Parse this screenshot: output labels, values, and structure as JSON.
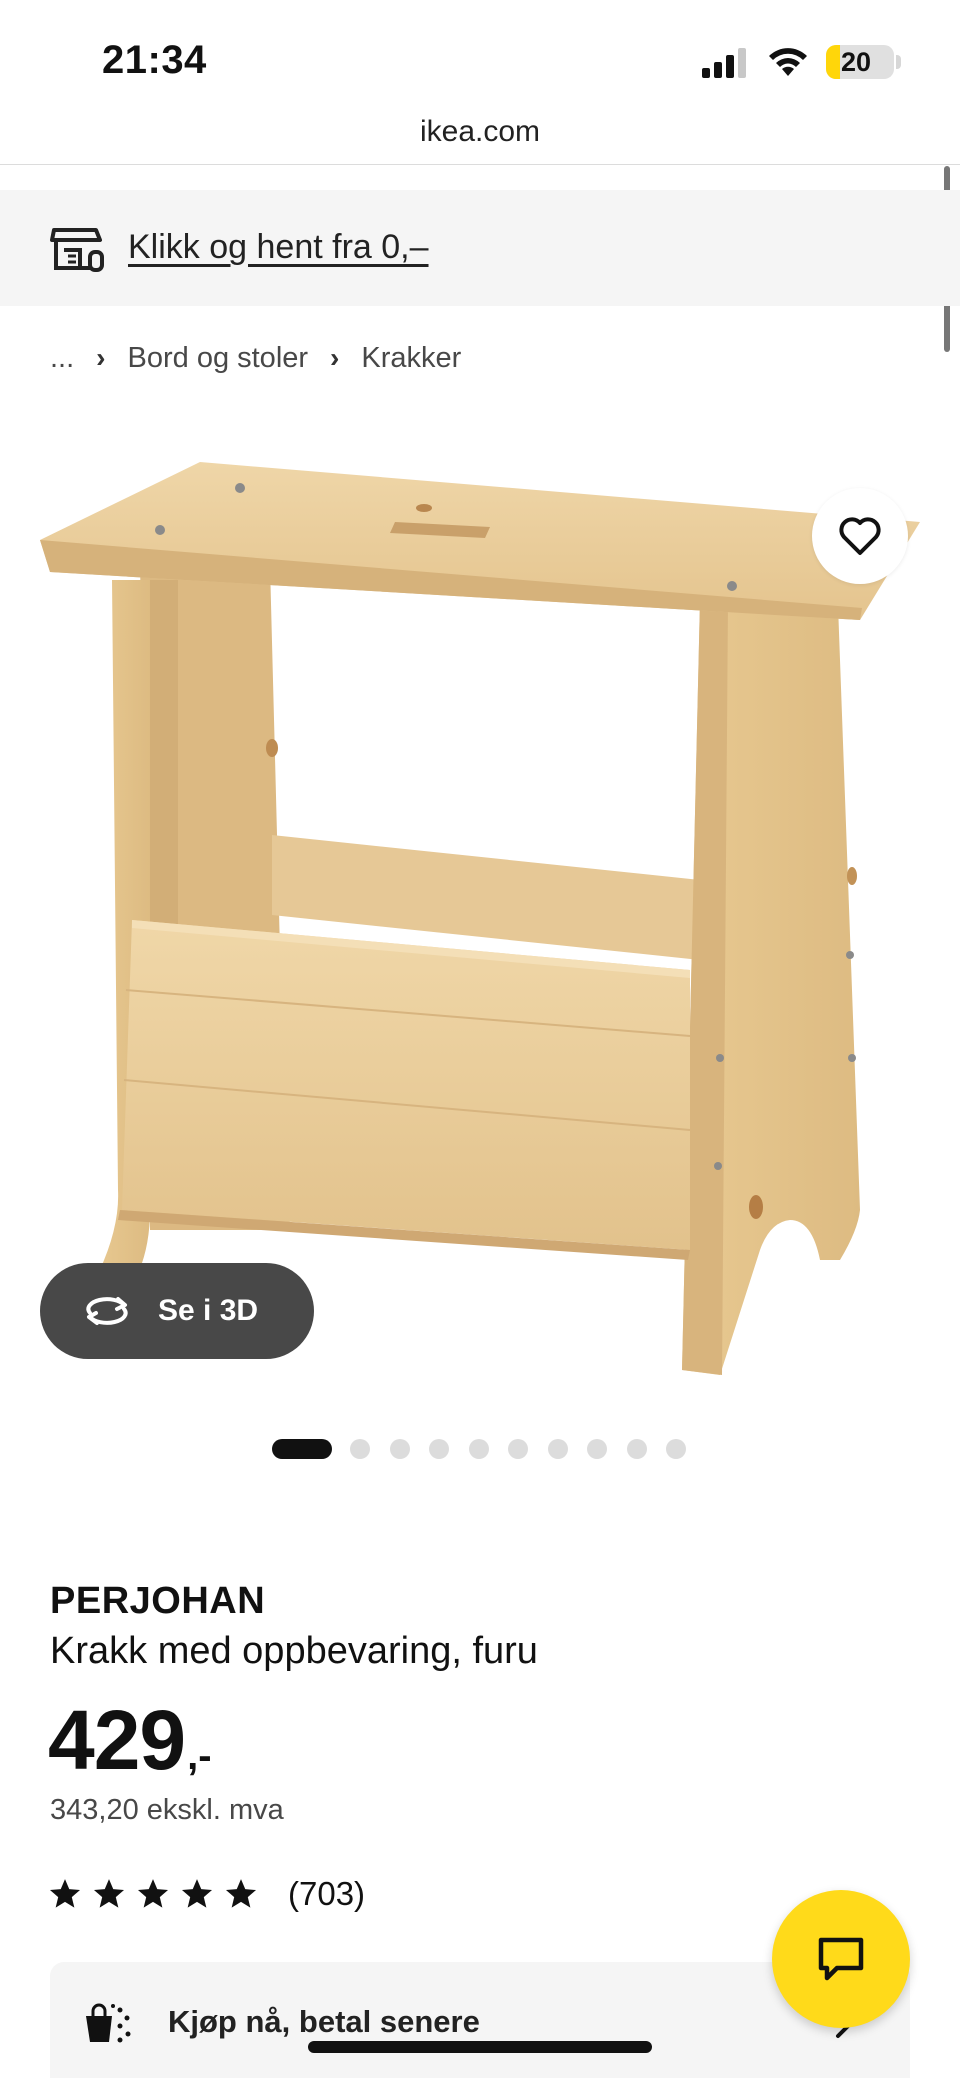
{
  "status_bar": {
    "time": "21:34",
    "battery_level": "20",
    "battery_fraction": 0.2,
    "signal_bars": 3,
    "signal_bars_max": 4
  },
  "browser": {
    "url": "ikea.com"
  },
  "promo_banner": {
    "text": "Klikk og hent fra 0,–",
    "icon": "store-pickup-icon"
  },
  "breadcrumb": {
    "ellipsis": "...",
    "separator_icon": "chevron-right-icon",
    "items": [
      "Bord og stoler",
      "Krakker"
    ]
  },
  "gallery": {
    "see_3d_label": "Se i 3D",
    "see_3d_icon": "rotate-3d-icon",
    "wishlist_icon": "heart-icon",
    "total_images": 10,
    "active_index": 0
  },
  "product": {
    "name": "PERJOHAN",
    "description": "Krakk med oppbevaring, furu",
    "price": "429",
    "price_suffix": ",-",
    "price_excl_vat": "343,20 ekskl. mva",
    "rating_stars": 5,
    "rating_count": "(703)"
  },
  "pay_later": {
    "label": "Kjøp nå, betal senere",
    "icon": "bag-sparkle-icon"
  },
  "chat": {
    "icon": "chat-bubble-icon"
  },
  "colors": {
    "ikea_yellow": "#FFDA1A",
    "dark_gray": "#484848",
    "light_gray_bg": "#F5F5F5",
    "wood_light": "#E9CC9A",
    "wood_mid": "#DDBB84",
    "wood_dark": "#C9A06A"
  }
}
